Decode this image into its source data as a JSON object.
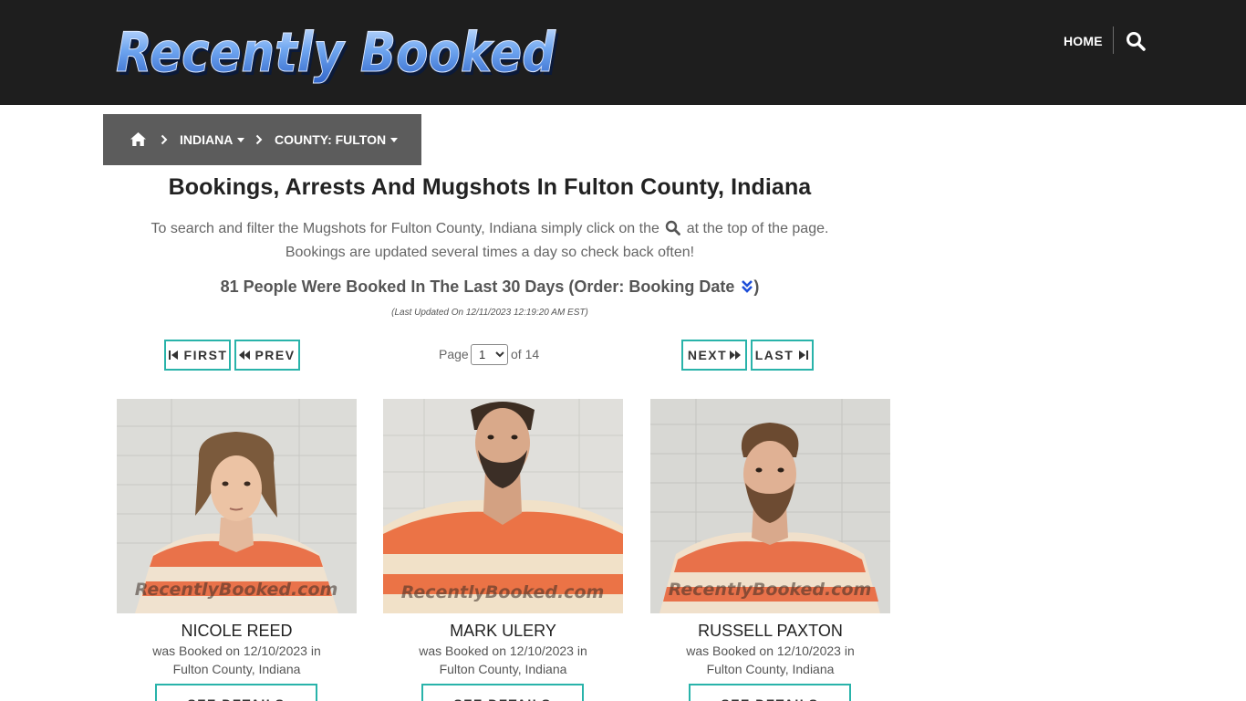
{
  "header": {
    "logo_text": "Recently Booked",
    "nav_home": "HOME",
    "search_icon": "search-icon"
  },
  "breadcrumb": {
    "home_icon": "home-icon",
    "state": "INDIANA",
    "county": "COUNTY: FULTON"
  },
  "page": {
    "title": "Bookings, Arrests And Mugshots In Fulton County, Indiana",
    "intro_part1": "To search and filter the Mugshots for Fulton County, Indiana simply click on the",
    "intro_part2": "at the top of the page.",
    "intro_line2": "Bookings are updated several times a day so check back often!",
    "count_text": "81 People Were Booked In The Last 30 Days (Order: Booking Date",
    "count_close": ")",
    "last_updated": "(Last Updated On 12/11/2023 12:19:20 AM EST)"
  },
  "pager": {
    "first": "FIRST",
    "prev": "PREV",
    "next": "NEXT",
    "last": "LAST",
    "page_label": "Page",
    "current_page": "1",
    "of_label": "of 14"
  },
  "watermark": "RecentlyBooked.com",
  "bookings": [
    {
      "name": "NICOLE REED",
      "line1": "was Booked on 12/10/2023 in",
      "line2": "Fulton County, Indiana",
      "button": "SEE DETAILS"
    },
    {
      "name": "MARK ULERY",
      "line1": "was Booked on 12/10/2023 in",
      "line2": "Fulton County, Indiana",
      "button": "SEE DETAILS"
    },
    {
      "name": "RUSSELL PAXTON",
      "line1": "was Booked on 12/10/2023 in",
      "line2": "Fulton County, Indiana",
      "button": "SEE DETAILS"
    }
  ],
  "colors": {
    "header_bg": "#1e1e1e",
    "breadcrumb_bg": "#5c5c5c",
    "accent_teal": "#29b3aa",
    "logo_blue": "#4f8fe6"
  }
}
